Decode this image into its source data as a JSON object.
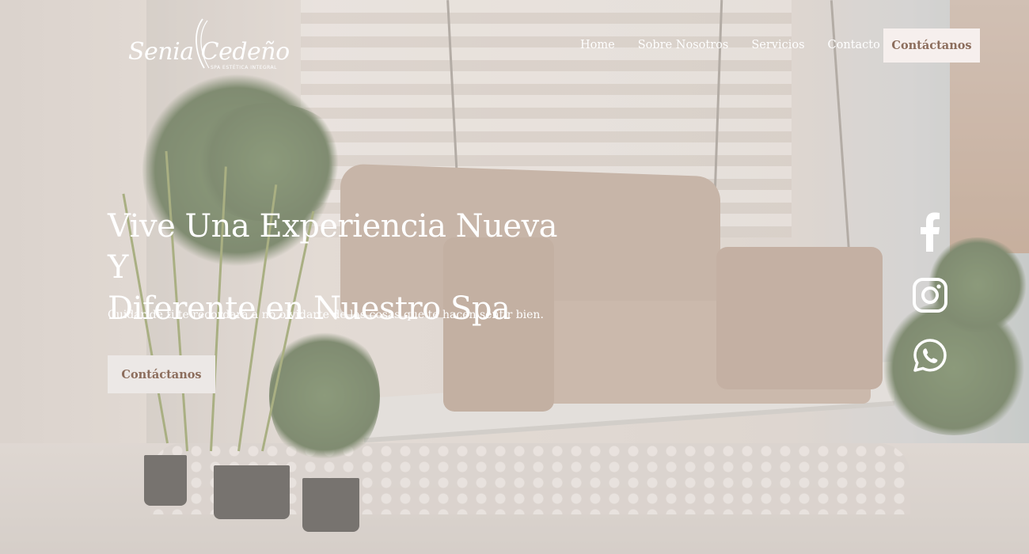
{
  "brand": {
    "logo_script": "Senia Cedeño",
    "logo_tagline": "SPA ESTÉTICA INTEGRAL"
  },
  "nav": {
    "items": [
      {
        "label": "Home"
      },
      {
        "label": "Sobre Nosotros"
      },
      {
        "label": "Servicios"
      },
      {
        "label": "Contacto"
      }
    ],
    "cta_label": "Contáctanos"
  },
  "hero": {
    "title_line1": "Vive Una Experiencia Nueva Y",
    "title_line2": "Diferente en Nuestro Spa",
    "subtitle": "Cuidar de ti te recordará a no olvidarte de las cosas que te hacen sentir bien.",
    "cta_label": "Contáctanos"
  },
  "social": [
    {
      "icon": "facebook-icon"
    },
    {
      "icon": "instagram-icon"
    },
    {
      "icon": "whatsapp-icon"
    }
  ],
  "colors": {
    "button_bg": "#f6efed",
    "button_text": "#8c6d5c",
    "text_on_image": "#ffffff"
  }
}
